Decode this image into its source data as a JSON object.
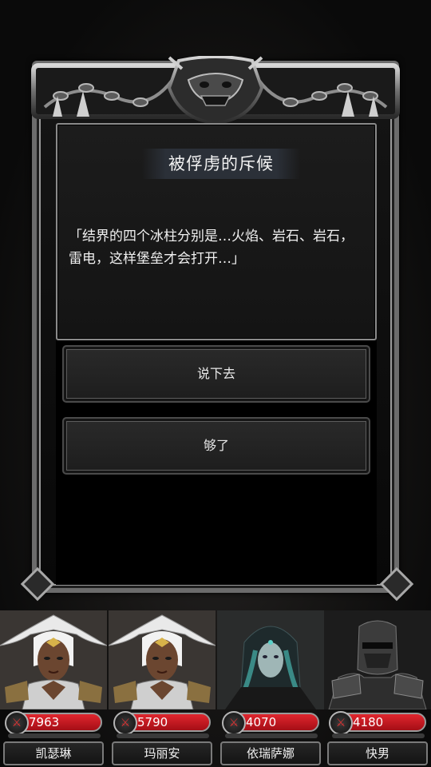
{
  "dialog": {
    "title": "被俘虏的斥候",
    "text": "「结界的四个冰柱分别是…火焰、岩石、岩石，雷电，这样堡垒才会打开…」",
    "choices": [
      "说下去",
      "够了"
    ]
  },
  "party": [
    {
      "name": "凯瑟琳",
      "hp": "7963",
      "portrait": "white-haired-priestess"
    },
    {
      "name": "玛丽安",
      "hp": "5790",
      "portrait": "white-haired-priestess"
    },
    {
      "name": "依瑞萨娜",
      "hp": "4070",
      "portrait": "hooded-sorceress"
    },
    {
      "name": "快男",
      "hp": "4180",
      "portrait": "armored-knight"
    }
  ],
  "colors": {
    "hp_bar": "#d01a22",
    "frame_metal": "#9a9a9a",
    "title_bg": "#2b3038"
  }
}
